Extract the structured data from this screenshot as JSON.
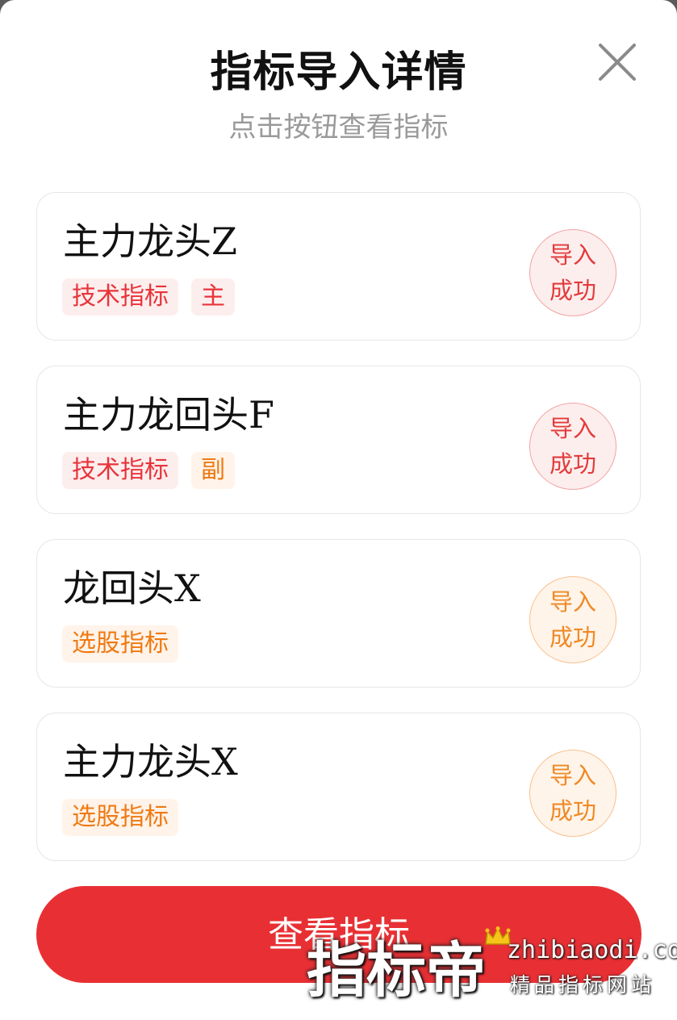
{
  "modal": {
    "title": "指标导入详情",
    "subtitle": "点击按钮查看指标"
  },
  "items": [
    {
      "name": "主力龙头Z",
      "tags": [
        {
          "label": "技术指标",
          "color": "#e8343a"
        },
        {
          "label": "主",
          "color": "#e8343a"
        }
      ],
      "status": "导入\n成功",
      "status_color": "#e33b3b"
    },
    {
      "name": "主力龙回头F",
      "tags": [
        {
          "label": "技术指标",
          "color": "#e8343a"
        },
        {
          "label": "副",
          "color": "#f07a12"
        }
      ],
      "status": "导入\n成功",
      "status_color": "#e33b3b"
    },
    {
      "name": "龙回头X",
      "tags": [
        {
          "label": "选股指标",
          "color": "#f07a12"
        }
      ],
      "status": "导入\n成功",
      "status_color": "#ef8a25"
    },
    {
      "name": "主力龙头X",
      "tags": [
        {
          "label": "选股指标",
          "color": "#f07a12"
        }
      ],
      "status": "导入\n成功",
      "status_color": "#ef8a25"
    }
  ],
  "primary_button": {
    "label": "查看指标",
    "color": "#e83034"
  },
  "watermark": {
    "brand": "指标帝",
    "url": "zhibiaodi.com",
    "slogan": "精品指标网站"
  },
  "icons": {
    "close": "close-icon",
    "crown": "crown-icon"
  }
}
